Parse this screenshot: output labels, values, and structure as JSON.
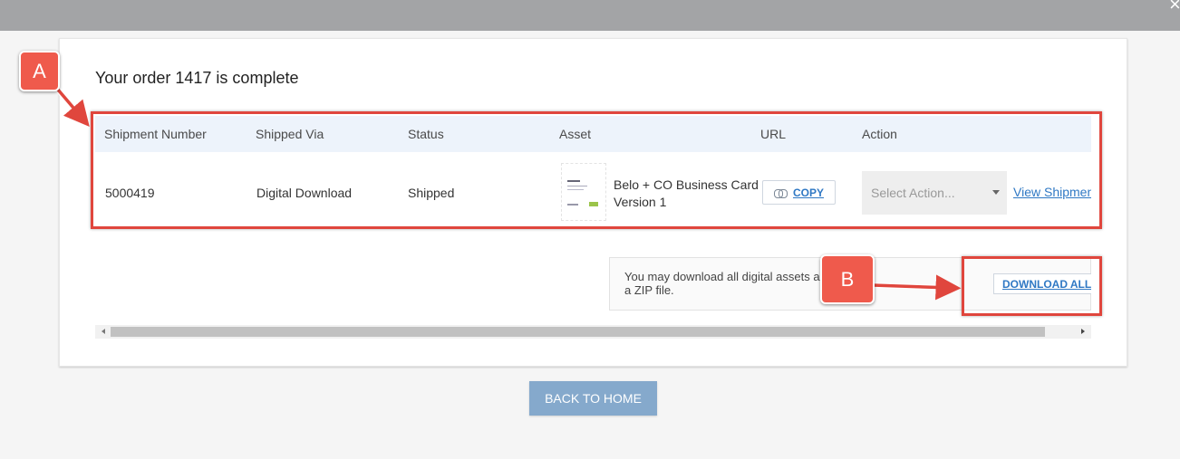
{
  "modal": {
    "close_symbol": "×"
  },
  "order": {
    "title": "Your order 1417 is complete"
  },
  "table": {
    "headers": [
      "Shipment Number",
      "Shipped Via",
      "Status",
      "Asset",
      "URL",
      "Action"
    ],
    "rows": [
      {
        "shipment_number": "5000419",
        "shipped_via": "Digital Download",
        "status": "Shipped",
        "asset_name": "Belo + CO Business Card Version 1",
        "url_button": "COPY",
        "action_placeholder": "Select Action...",
        "view_link": "View Shipment"
      }
    ]
  },
  "download": {
    "text": "You may download all digital assets as a ZIP file.",
    "button": "DOWNLOAD ALL"
  },
  "footer": {
    "back_home": "BACK TO HOME"
  },
  "annotations": {
    "a": "A",
    "b": "B"
  },
  "icons": {
    "copy": "link-icon",
    "close": "close-icon",
    "dropdown": "chevron-down-icon"
  },
  "colors": {
    "annotation": "#e0463d",
    "callout_fill": "#ef5a4c",
    "link": "#2f78c4",
    "primary_button": "#85a9cc",
    "header_bg": "#edf3fb"
  }
}
